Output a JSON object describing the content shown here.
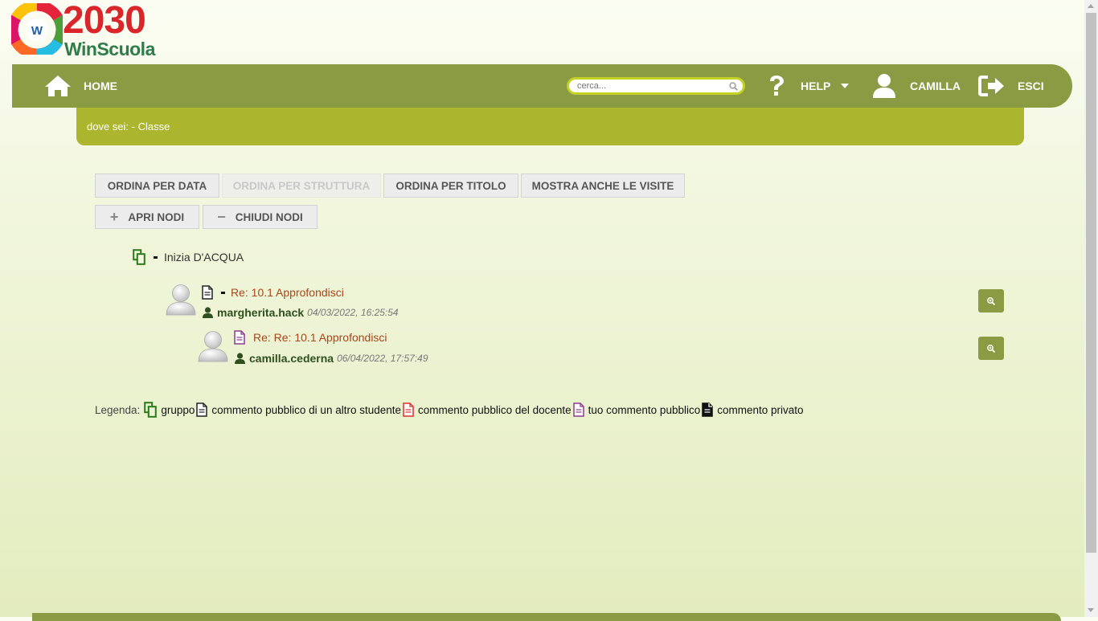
{
  "logo": {
    "year": "2030",
    "name": "WinScuola"
  },
  "nav": {
    "home": "HOME",
    "search_placeholder": "cerca...",
    "help": "HELP",
    "user": "CAMILLA",
    "logout": "ESCI"
  },
  "breadcrumb": "dove sei: - Classe",
  "toolbar": {
    "sort_date": "ORDINA PER DATA",
    "sort_structure": "ORDINA PER STRUTTURA",
    "sort_title": "ORDINA PER TITOLO",
    "show_visits": "MOSTRA ANCHE LE VISITE",
    "open_nodes": "APRI NODI",
    "close_nodes": "CHIUDI NODI"
  },
  "tree": {
    "root_title": "Inizia D'ACQUA",
    "posts": [
      {
        "title": "Re: 10.1 Approfondisci",
        "user": "margherita.hack",
        "date": "04/03/2022, 16:25:54"
      },
      {
        "title": "Re: Re: 10.1 Approfondisci",
        "user": "camilla.cederna",
        "date": "06/04/2022, 17:57:49"
      }
    ]
  },
  "legend": {
    "label": "Legenda:",
    "items": [
      "gruppo",
      "commento pubblico di un altro studente",
      "commento pubblico del docente",
      "tuo commento pubblico",
      "commento privato"
    ]
  },
  "colors": {
    "nav": "#8a9b43",
    "breadcrumb": "#abb62e",
    "link": "#a6471d",
    "group_icon": "#2a7a1a",
    "teacher_icon": "#e0302a",
    "own_icon": "#8e3a8e"
  }
}
